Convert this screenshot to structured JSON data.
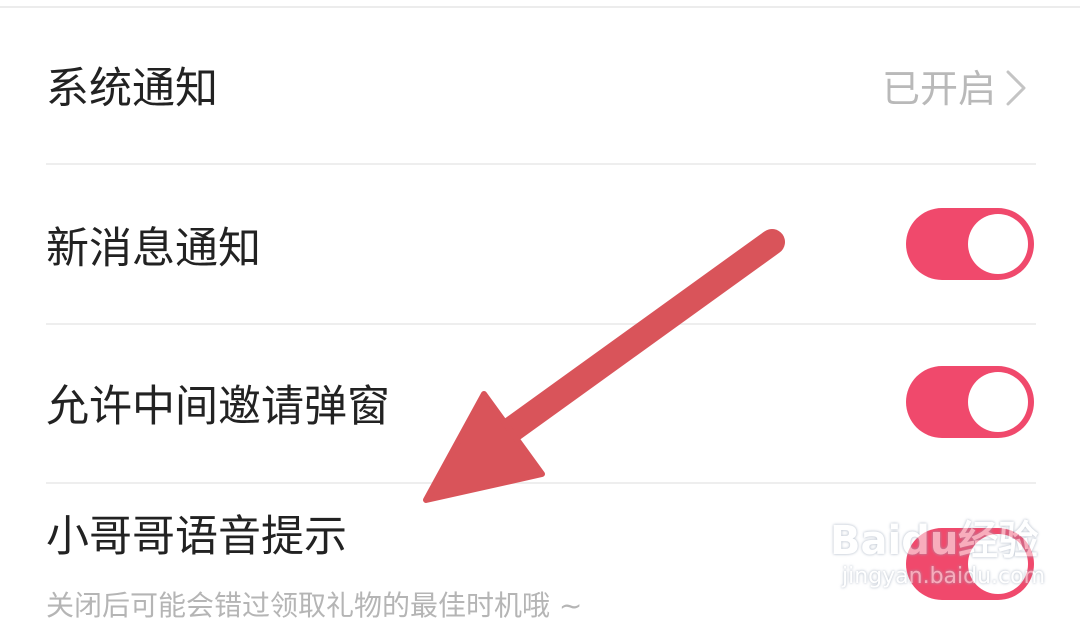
{
  "colors": {
    "accent": "#f0496c",
    "arrow": "#d9545a",
    "secondary_text": "#b9b9b9"
  },
  "settings": {
    "system_notification": {
      "label": "系统通知",
      "value": "已开启",
      "icon": "chevron-right-icon"
    },
    "new_message_notification": {
      "label": "新消息通知",
      "enabled": true
    },
    "allow_invite_popup": {
      "label": "允许中间邀请弹窗",
      "enabled": true
    },
    "voice_prompt": {
      "label": "小哥哥语音提示",
      "description": "关闭后可能会错过领取礼物的最佳时机哦 ~",
      "enabled": true
    }
  },
  "annotation": {
    "icon": "arrow-annotation-icon"
  },
  "watermark": {
    "brand": "Baidu经验",
    "url": "jingyan.baidu.com"
  }
}
